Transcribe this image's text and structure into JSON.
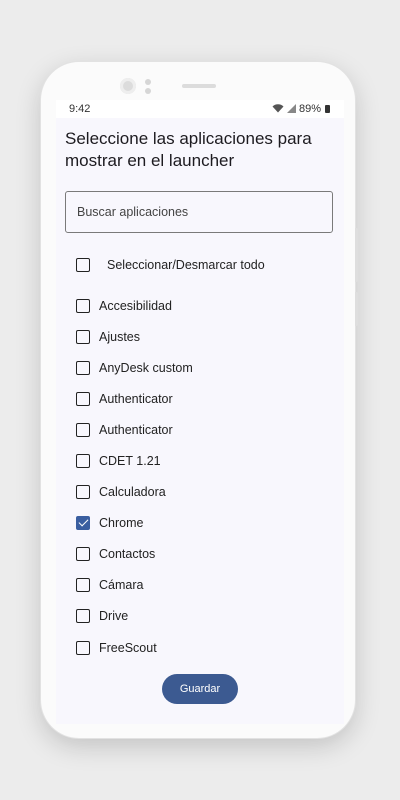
{
  "status_bar": {
    "time": "9:42",
    "battery": "89%"
  },
  "title": "Seleccione las aplicaciones para mostrar en el launcher",
  "search": {
    "placeholder": "Buscar aplicaciones"
  },
  "select_all": {
    "label": "Seleccionar/Desmarcar todo",
    "checked": false
  },
  "apps": [
    {
      "label": "Accesibilidad",
      "checked": false
    },
    {
      "label": "Ajustes",
      "checked": false
    },
    {
      "label": "AnyDesk custom",
      "checked": false
    },
    {
      "label": "Authenticator",
      "checked": false
    },
    {
      "label": "Authenticator",
      "checked": false
    },
    {
      "label": "CDET 1.21",
      "checked": false
    },
    {
      "label": "Calculadora",
      "checked": false
    },
    {
      "label": "Chrome",
      "checked": true
    },
    {
      "label": "Contactos",
      "checked": false
    },
    {
      "label": "Cámara",
      "checked": false
    },
    {
      "label": "Drive",
      "checked": false
    },
    {
      "label": "FreeScout",
      "checked": false
    }
  ],
  "save_button": {
    "label": "Guardar"
  },
  "colors": {
    "accent": "#3c5a91",
    "checkbox_checked": "#3a5ea0",
    "screen_bg": "#f8f7fd"
  },
  "icons": {
    "wifi": "wifi-icon",
    "signal": "signal-icon",
    "battery": "battery-icon",
    "checkbox": "checkbox-icon"
  }
}
